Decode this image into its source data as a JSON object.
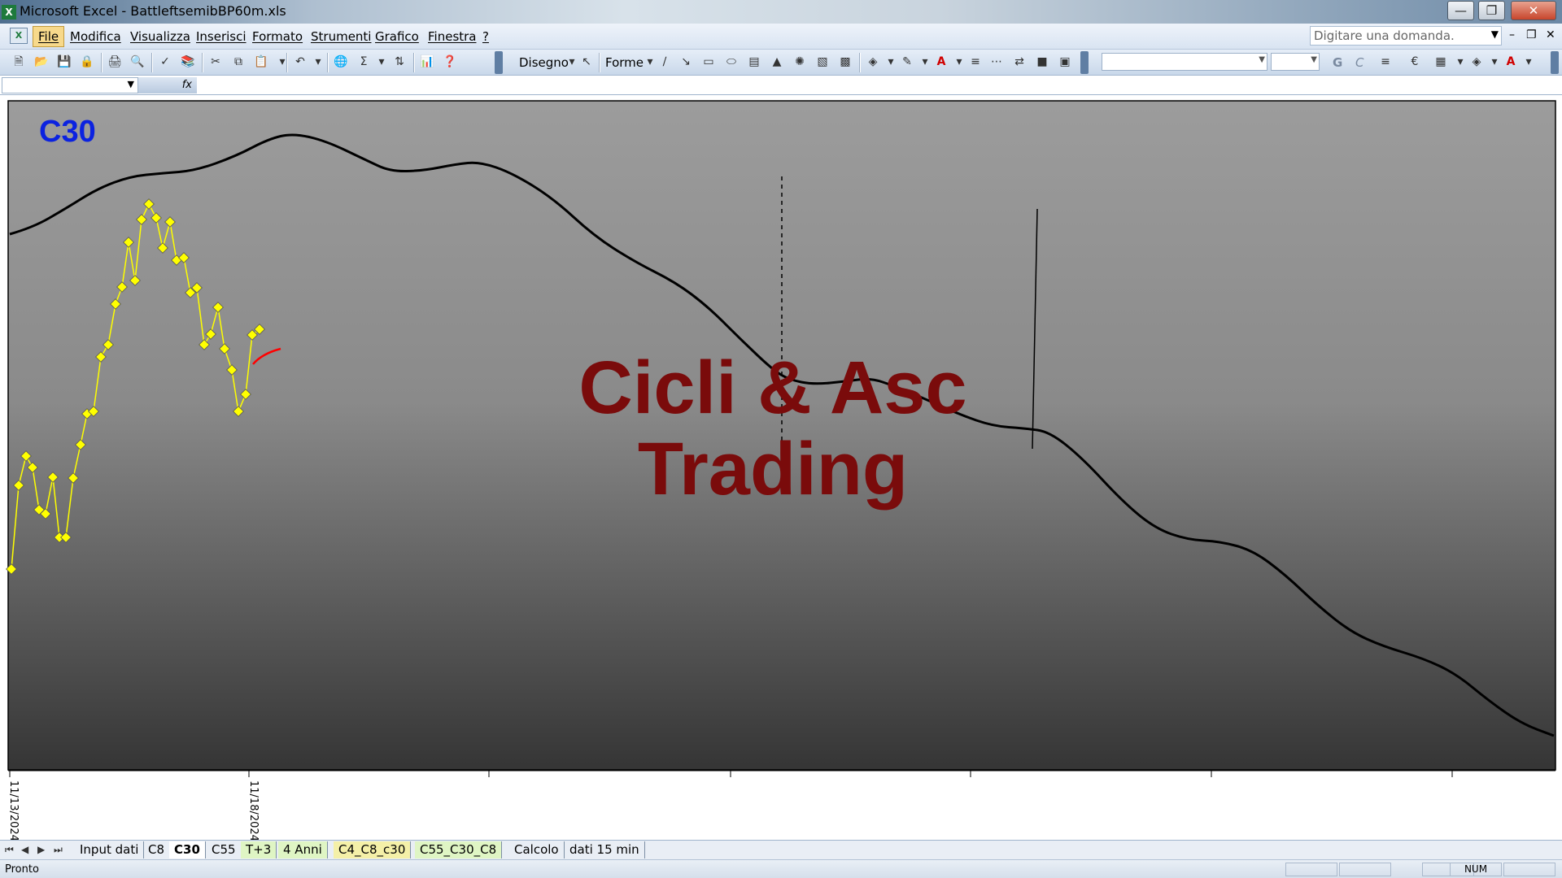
{
  "window": {
    "title": "Microsoft Excel - BattleftsemibBP60m.xls",
    "controls": [
      "minimize-icon",
      "restore-icon",
      "close-icon"
    ]
  },
  "menu": {
    "items": [
      "File",
      "Modifica",
      "Visualizza",
      "Inserisci",
      "Formato",
      "Strumenti",
      "Grafico",
      "Finestra",
      "?"
    ],
    "active": "File",
    "question_placeholder": "Digitare una domanda."
  },
  "toolbar": {
    "drawing_label": "Disegno",
    "shapes_label": "Forme",
    "bold_label": "G",
    "italic_label": "C"
  },
  "formula_bar": {
    "fx_label": "fx"
  },
  "chart": {
    "label": "C30",
    "watermark_line1": "Cicli & Asc",
    "watermark_line2": "Trading",
    "x_tick_labels": [
      "11/13/2024",
      "11/18/2024"
    ],
    "colors": {
      "price_line": "#ffff00",
      "cycle_line": "#000000",
      "projection": "#ff0000",
      "label": "#0b22e0",
      "watermark": "#7a0b0b"
    },
    "background": "dark-gradient"
  },
  "sheet_tabs": {
    "tabs": [
      "Input dati",
      "C8",
      "C30",
      "C55",
      "T+3",
      "4 Anni",
      "C4_C8_c30",
      "C55_C30_C8",
      "Calcolo",
      "dati 15 min"
    ],
    "active": "C30"
  },
  "status": {
    "text": "Pronto",
    "num_indicator": "NUM"
  }
}
